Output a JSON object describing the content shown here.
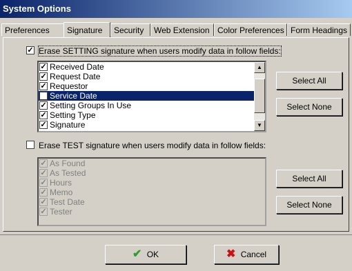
{
  "window": {
    "title": "System Options"
  },
  "tabs": [
    {
      "label": "Preferences"
    },
    {
      "label": "Signature"
    },
    {
      "label": "Security"
    },
    {
      "label": "Web Extension"
    },
    {
      "label": "Color Preferences"
    },
    {
      "label": "Form Headings"
    }
  ],
  "setting_section": {
    "checkbox_label": "Erase SETTING signature when users modify data in follow fields:",
    "checked": true,
    "items": [
      {
        "label": "Received Date",
        "checked": true
      },
      {
        "label": "Request Date",
        "checked": true
      },
      {
        "label": "Requestor",
        "checked": true
      },
      {
        "label": "Service Date",
        "checked": false,
        "selected": true
      },
      {
        "label": "Setting Groups In Use",
        "checked": true
      },
      {
        "label": "Setting Type",
        "checked": true
      },
      {
        "label": "Signature",
        "checked": true
      }
    ],
    "select_all": "Select All",
    "select_none": "Select None"
  },
  "test_section": {
    "checkbox_label": "Erase TEST signature when users modify data in follow fields:",
    "checked": false,
    "items": [
      {
        "label": "As Found",
        "checked": true
      },
      {
        "label": "As Tested",
        "checked": true
      },
      {
        "label": "Hours",
        "checked": true
      },
      {
        "label": "Memo",
        "checked": true
      },
      {
        "label": "Test Date",
        "checked": true
      },
      {
        "label": "Tester",
        "checked": true
      }
    ],
    "select_all": "Select All",
    "select_none": "Select None"
  },
  "footer": {
    "ok_label": "OK",
    "cancel_label": "Cancel"
  },
  "colors": {
    "title_bar": "#0a246a",
    "selection": "#0a246a",
    "ok_check": "#2e9d2e",
    "cancel_x": "#cc1111"
  }
}
